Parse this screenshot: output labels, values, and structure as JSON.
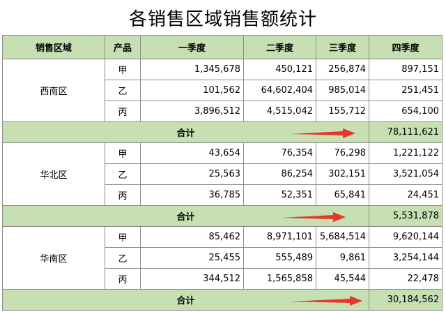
{
  "title": "各销售区域销售额统计",
  "headers": [
    "销售区域",
    "产品",
    "一季度",
    "二季度",
    "三季度",
    "四季度"
  ],
  "total_label": "合计",
  "colors": {
    "header_bg": "#c6e0b4",
    "arrow": "#e8362a"
  },
  "regions": [
    {
      "name": "西南区",
      "rows": [
        {
          "product": "甲",
          "q1": "1,345,678",
          "q2": "450,121",
          "q3": "256,874",
          "q4": "897,151"
        },
        {
          "product": "乙",
          "q1": "101,562",
          "q2": "64,602,404",
          "q3": "985,014",
          "q4": "251,451"
        },
        {
          "product": "丙",
          "q1": "3,896,512",
          "q2": "4,515,042",
          "q3": "155,712",
          "q4": "654,100"
        }
      ],
      "total": "78,111,621"
    },
    {
      "name": "华北区",
      "rows": [
        {
          "product": "甲",
          "q1": "43,654",
          "q2": "76,354",
          "q3": "76,298",
          "q4": "1,221,122"
        },
        {
          "product": "乙",
          "q1": "25,563",
          "q2": "86,254",
          "q3": "302,151",
          "q4": "3,521,054"
        },
        {
          "product": "丙",
          "q1": "36,785",
          "q2": "52,351",
          "q3": "65,841",
          "q4": "24,451"
        }
      ],
      "total": "5,531,878"
    },
    {
      "name": "华南区",
      "rows": [
        {
          "product": "甲",
          "q1": "85,462",
          "q2": "8,971,101",
          "q3": "5,684,514",
          "q4": "9,620,144"
        },
        {
          "product": "乙",
          "q1": "25,455",
          "q2": "555,489",
          "q3": "9,861",
          "q4": "3,254,144"
        },
        {
          "product": "丙",
          "q1": "344,512",
          "q2": "1,565,858",
          "q3": "45,544",
          "q4": "22,478"
        }
      ],
      "total": "30,184,562"
    }
  ]
}
